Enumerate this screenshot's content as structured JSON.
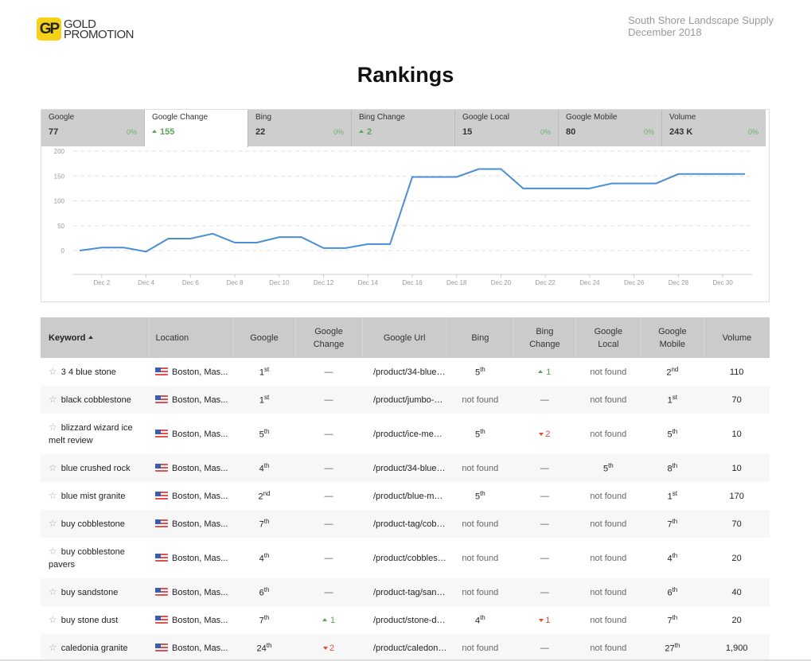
{
  "logo": {
    "badge": "GP",
    "line1": "GOLD",
    "line2": "PROMOTION"
  },
  "client": {
    "name": "South Shore Landscape Supply",
    "period": "December 2018"
  },
  "page_title": "Rankings",
  "tabs": [
    {
      "label": "Google",
      "value": "77",
      "pct": "0%",
      "trend": "none",
      "active": false
    },
    {
      "label": "Google Change",
      "value": "155",
      "pct": "",
      "trend": "up",
      "active": true
    },
    {
      "label": "Bing",
      "value": "22",
      "pct": "0%",
      "trend": "none",
      "active": false
    },
    {
      "label": "Bing Change",
      "value": "2",
      "pct": "",
      "trend": "up",
      "active": false
    },
    {
      "label": "Google Local",
      "value": "15",
      "pct": "0%",
      "trend": "none",
      "active": false
    },
    {
      "label": "Google Mobile",
      "value": "80",
      "pct": "0%",
      "trend": "none",
      "active": false
    },
    {
      "label": "Volume",
      "value": "243 K",
      "pct": "0%",
      "trend": "none",
      "active": false
    }
  ],
  "chart_data": {
    "type": "line",
    "title": "",
    "xlabel": "",
    "ylabel": "",
    "ylim": [
      -50,
      200
    ],
    "yticks": [
      0,
      50,
      100,
      150,
      200
    ],
    "grid": true,
    "line_color": "#4a8fd4",
    "x": [
      "Dec 1",
      "Dec 2",
      "Dec 3",
      "Dec 4",
      "Dec 5",
      "Dec 6",
      "Dec 7",
      "Dec 8",
      "Dec 9",
      "Dec 10",
      "Dec 11",
      "Dec 12",
      "Dec 13",
      "Dec 14",
      "Dec 15",
      "Dec 16",
      "Dec 17",
      "Dec 18",
      "Dec 19",
      "Dec 20",
      "Dec 21",
      "Dec 22",
      "Dec 23",
      "Dec 24",
      "Dec 25",
      "Dec 26",
      "Dec 27",
      "Dec 28",
      "Dec 29",
      "Dec 30",
      "Dec 31"
    ],
    "xtick_labels": [
      "Dec 2",
      "Dec 4",
      "Dec 6",
      "Dec 8",
      "Dec 10",
      "Dec 12",
      "Dec 14",
      "Dec 16",
      "Dec 18",
      "Dec 20",
      "Dec 22",
      "Dec 24",
      "Dec 26",
      "Dec 28",
      "Dec 30"
    ],
    "series": [
      {
        "name": "Google Change",
        "values": [
          0,
          6,
          6,
          -2,
          24,
          24,
          34,
          16,
          16,
          27,
          27,
          5,
          5,
          13,
          13,
          148,
          148,
          148,
          164,
          164,
          125,
          125,
          125,
          125,
          135,
          135,
          135,
          154,
          154,
          154,
          154
        ]
      }
    ]
  },
  "table": {
    "headers": {
      "keyword": "Keyword",
      "location": "Location",
      "google": "Google",
      "google_change_1": "Google",
      "google_change_2": "Change",
      "google_url": "Google Url",
      "bing": "Bing",
      "bing_change_1": "Bing",
      "bing_change_2": "Change",
      "google_local_1": "Google",
      "google_local_2": "Local",
      "google_mobile_1": "Google",
      "google_mobile_2": "Mobile",
      "volume": "Volume"
    },
    "rows": [
      {
        "keyword": "3 4 blue stone",
        "location": "Boston, Mas...",
        "google": "1",
        "google_sfx": "st",
        "google_change": "—",
        "gc_trend": "none",
        "url": "/product/34-blue…",
        "bing": "5",
        "bing_sfx": "th",
        "bing_change": "1",
        "bc_trend": "up",
        "local": "not found",
        "local_sfx": "",
        "mobile": "2",
        "mobile_sfx": "nd",
        "volume": "110"
      },
      {
        "keyword": "black cobblestone",
        "location": "Boston, Mas...",
        "google": "1",
        "google_sfx": "st",
        "google_change": "—",
        "gc_trend": "none",
        "url": "/product/jumbo-…",
        "bing": "not found",
        "bing_sfx": "",
        "bing_change": "—",
        "bc_trend": "none",
        "local": "not found",
        "local_sfx": "",
        "mobile": "1",
        "mobile_sfx": "st",
        "volume": "70"
      },
      {
        "keyword": "blizzard wizard ice melt review",
        "location": "Boston, Mas...",
        "google": "5",
        "google_sfx": "th",
        "google_change": "—",
        "gc_trend": "none",
        "url": "/product/ice-me…",
        "bing": "5",
        "bing_sfx": "th",
        "bing_change": "2",
        "bc_trend": "down",
        "local": "not found",
        "local_sfx": "",
        "mobile": "5",
        "mobile_sfx": "th",
        "volume": "10"
      },
      {
        "keyword": "blue crushed rock",
        "location": "Boston, Mas...",
        "google": "4",
        "google_sfx": "th",
        "google_change": "—",
        "gc_trend": "none",
        "url": "/product/34-blue…",
        "bing": "not found",
        "bing_sfx": "",
        "bing_change": "—",
        "bc_trend": "none",
        "local": "5",
        "local_sfx": "th",
        "mobile": "8",
        "mobile_sfx": "th",
        "volume": "10"
      },
      {
        "keyword": "blue mist granite",
        "location": "Boston, Mas...",
        "google": "2",
        "google_sfx": "nd",
        "google_change": "—",
        "gc_trend": "none",
        "url": "/product/blue-m…",
        "bing": "5",
        "bing_sfx": "th",
        "bing_change": "—",
        "bc_trend": "none",
        "local": "not found",
        "local_sfx": "",
        "mobile": "1",
        "mobile_sfx": "st",
        "volume": "170"
      },
      {
        "keyword": "buy cobblestone",
        "location": "Boston, Mas...",
        "google": "7",
        "google_sfx": "th",
        "google_change": "—",
        "gc_trend": "none",
        "url": "/product-tag/cob…",
        "bing": "not found",
        "bing_sfx": "",
        "bing_change": "—",
        "bc_trend": "none",
        "local": "not found",
        "local_sfx": "",
        "mobile": "7",
        "mobile_sfx": "th",
        "volume": "70"
      },
      {
        "keyword": "buy cobblestone pavers",
        "location": "Boston, Mas...",
        "google": "4",
        "google_sfx": "th",
        "google_change": "—",
        "gc_trend": "none",
        "url": "/product/cobbles…",
        "bing": "not found",
        "bing_sfx": "",
        "bing_change": "—",
        "bc_trend": "none",
        "local": "not found",
        "local_sfx": "",
        "mobile": "4",
        "mobile_sfx": "th",
        "volume": "20"
      },
      {
        "keyword": "buy sandstone",
        "location": "Boston, Mas...",
        "google": "6",
        "google_sfx": "th",
        "google_change": "—",
        "gc_trend": "none",
        "url": "/product-tag/san…",
        "bing": "not found",
        "bing_sfx": "",
        "bing_change": "—",
        "bc_trend": "none",
        "local": "not found",
        "local_sfx": "",
        "mobile": "6",
        "mobile_sfx": "th",
        "volume": "40"
      },
      {
        "keyword": "buy stone dust",
        "location": "Boston, Mas...",
        "google": "7",
        "google_sfx": "th",
        "google_change": "1",
        "gc_trend": "up",
        "url": "/product/stone-d…",
        "bing": "4",
        "bing_sfx": "th",
        "bing_change": "1",
        "bc_trend": "down",
        "local": "not found",
        "local_sfx": "",
        "mobile": "7",
        "mobile_sfx": "th",
        "volume": "20"
      },
      {
        "keyword": "caledonia granite",
        "location": "Boston, Mas...",
        "google": "24",
        "google_sfx": "th",
        "google_change": "2",
        "gc_trend": "down",
        "url": "/product/caledon…",
        "bing": "not found",
        "bing_sfx": "",
        "bing_change": "—",
        "bc_trend": "none",
        "local": "not found",
        "local_sfx": "",
        "mobile": "27",
        "mobile_sfx": "th",
        "volume": "1,900"
      }
    ]
  }
}
